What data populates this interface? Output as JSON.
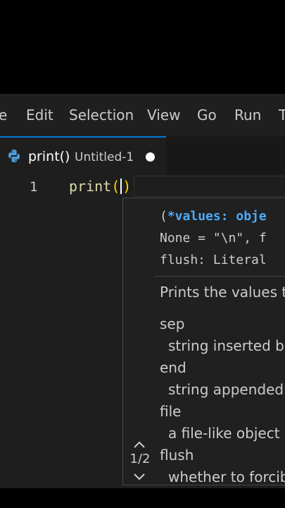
{
  "menubar": {
    "items": [
      "e",
      "Edit",
      "Selection",
      "View",
      "Go",
      "Run",
      "T"
    ]
  },
  "tab": {
    "name": "print()",
    "file": "Untitled-1",
    "icon": "python-icon"
  },
  "editor": {
    "line_number": "1",
    "code_fn": "print",
    "code_open": "(",
    "code_close": ")"
  },
  "hover": {
    "signature": {
      "open": "(",
      "active_param": "*values: obje",
      "line2": "None = \"\\n\", f",
      "line3": "flush: Literal"
    },
    "summary": "Prints the values t",
    "params": [
      {
        "name": "sep",
        "desc": "string inserted be"
      },
      {
        "name": "end",
        "desc": "string appended"
      },
      {
        "name": "file",
        "desc": "a file-like object"
      },
      {
        "name": "flush",
        "desc": "whether to forcib"
      }
    ],
    "overload_counter": "1/2"
  },
  "colors": {
    "background": "#1e1e1e",
    "accent": "#0078d4",
    "function": "#dcdcaa",
    "bracket": "#ffd700",
    "active_param": "#4daafc"
  }
}
